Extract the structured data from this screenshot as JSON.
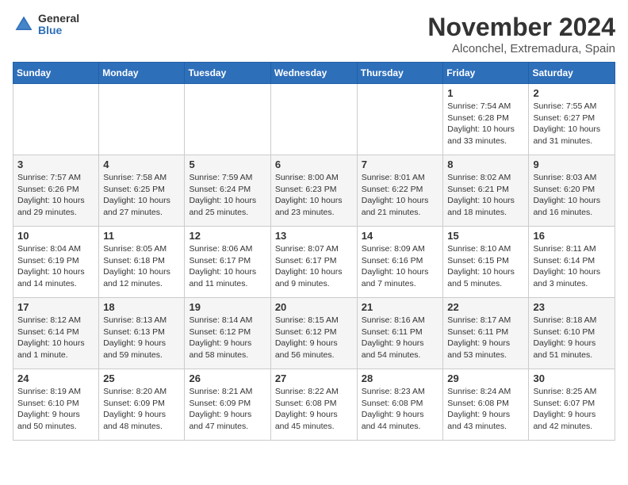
{
  "header": {
    "logo_general": "General",
    "logo_blue": "Blue",
    "month": "November 2024",
    "location": "Alconchel, Extremadura, Spain"
  },
  "weekdays": [
    "Sunday",
    "Monday",
    "Tuesday",
    "Wednesday",
    "Thursday",
    "Friday",
    "Saturday"
  ],
  "weeks": [
    [
      {
        "day": "",
        "info": ""
      },
      {
        "day": "",
        "info": ""
      },
      {
        "day": "",
        "info": ""
      },
      {
        "day": "",
        "info": ""
      },
      {
        "day": "",
        "info": ""
      },
      {
        "day": "1",
        "info": "Sunrise: 7:54 AM\nSunset: 6:28 PM\nDaylight: 10 hours and 33 minutes."
      },
      {
        "day": "2",
        "info": "Sunrise: 7:55 AM\nSunset: 6:27 PM\nDaylight: 10 hours and 31 minutes."
      }
    ],
    [
      {
        "day": "3",
        "info": "Sunrise: 7:57 AM\nSunset: 6:26 PM\nDaylight: 10 hours and 29 minutes."
      },
      {
        "day": "4",
        "info": "Sunrise: 7:58 AM\nSunset: 6:25 PM\nDaylight: 10 hours and 27 minutes."
      },
      {
        "day": "5",
        "info": "Sunrise: 7:59 AM\nSunset: 6:24 PM\nDaylight: 10 hours and 25 minutes."
      },
      {
        "day": "6",
        "info": "Sunrise: 8:00 AM\nSunset: 6:23 PM\nDaylight: 10 hours and 23 minutes."
      },
      {
        "day": "7",
        "info": "Sunrise: 8:01 AM\nSunset: 6:22 PM\nDaylight: 10 hours and 21 minutes."
      },
      {
        "day": "8",
        "info": "Sunrise: 8:02 AM\nSunset: 6:21 PM\nDaylight: 10 hours and 18 minutes."
      },
      {
        "day": "9",
        "info": "Sunrise: 8:03 AM\nSunset: 6:20 PM\nDaylight: 10 hours and 16 minutes."
      }
    ],
    [
      {
        "day": "10",
        "info": "Sunrise: 8:04 AM\nSunset: 6:19 PM\nDaylight: 10 hours and 14 minutes."
      },
      {
        "day": "11",
        "info": "Sunrise: 8:05 AM\nSunset: 6:18 PM\nDaylight: 10 hours and 12 minutes."
      },
      {
        "day": "12",
        "info": "Sunrise: 8:06 AM\nSunset: 6:17 PM\nDaylight: 10 hours and 11 minutes."
      },
      {
        "day": "13",
        "info": "Sunrise: 8:07 AM\nSunset: 6:17 PM\nDaylight: 10 hours and 9 minutes."
      },
      {
        "day": "14",
        "info": "Sunrise: 8:09 AM\nSunset: 6:16 PM\nDaylight: 10 hours and 7 minutes."
      },
      {
        "day": "15",
        "info": "Sunrise: 8:10 AM\nSunset: 6:15 PM\nDaylight: 10 hours and 5 minutes."
      },
      {
        "day": "16",
        "info": "Sunrise: 8:11 AM\nSunset: 6:14 PM\nDaylight: 10 hours and 3 minutes."
      }
    ],
    [
      {
        "day": "17",
        "info": "Sunrise: 8:12 AM\nSunset: 6:14 PM\nDaylight: 10 hours and 1 minute."
      },
      {
        "day": "18",
        "info": "Sunrise: 8:13 AM\nSunset: 6:13 PM\nDaylight: 9 hours and 59 minutes."
      },
      {
        "day": "19",
        "info": "Sunrise: 8:14 AM\nSunset: 6:12 PM\nDaylight: 9 hours and 58 minutes."
      },
      {
        "day": "20",
        "info": "Sunrise: 8:15 AM\nSunset: 6:12 PM\nDaylight: 9 hours and 56 minutes."
      },
      {
        "day": "21",
        "info": "Sunrise: 8:16 AM\nSunset: 6:11 PM\nDaylight: 9 hours and 54 minutes."
      },
      {
        "day": "22",
        "info": "Sunrise: 8:17 AM\nSunset: 6:11 PM\nDaylight: 9 hours and 53 minutes."
      },
      {
        "day": "23",
        "info": "Sunrise: 8:18 AM\nSunset: 6:10 PM\nDaylight: 9 hours and 51 minutes."
      }
    ],
    [
      {
        "day": "24",
        "info": "Sunrise: 8:19 AM\nSunset: 6:10 PM\nDaylight: 9 hours and 50 minutes."
      },
      {
        "day": "25",
        "info": "Sunrise: 8:20 AM\nSunset: 6:09 PM\nDaylight: 9 hours and 48 minutes."
      },
      {
        "day": "26",
        "info": "Sunrise: 8:21 AM\nSunset: 6:09 PM\nDaylight: 9 hours and 47 minutes."
      },
      {
        "day": "27",
        "info": "Sunrise: 8:22 AM\nSunset: 6:08 PM\nDaylight: 9 hours and 45 minutes."
      },
      {
        "day": "28",
        "info": "Sunrise: 8:23 AM\nSunset: 6:08 PM\nDaylight: 9 hours and 44 minutes."
      },
      {
        "day": "29",
        "info": "Sunrise: 8:24 AM\nSunset: 6:08 PM\nDaylight: 9 hours and 43 minutes."
      },
      {
        "day": "30",
        "info": "Sunrise: 8:25 AM\nSunset: 6:07 PM\nDaylight: 9 hours and 42 minutes."
      }
    ]
  ]
}
